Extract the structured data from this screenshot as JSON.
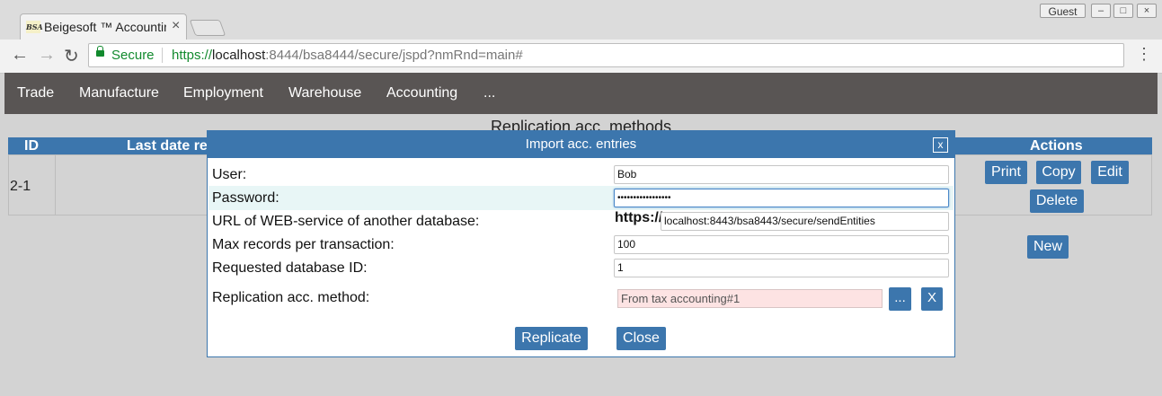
{
  "browser": {
    "tab_title": "Beigesoft ™ Accounting",
    "favicon_text": "BSA",
    "guest_label": "Guest",
    "secure_label": "Secure",
    "url_scheme": "https://",
    "url_host": "localhost",
    "url_path": ":8444/bsa8444/secure/jspd?nmRnd=main#"
  },
  "nav": {
    "items": [
      "Trade",
      "Manufacture",
      "Employment",
      "Warehouse",
      "Accounting",
      "..."
    ]
  },
  "page": {
    "title": "Replication acc. methods",
    "columns": {
      "id": "ID",
      "last_date": "Last date re",
      "actions": "Actions"
    },
    "rows": [
      {
        "id": "2-1"
      }
    ],
    "buttons": {
      "print": "Print",
      "copy": "Copy",
      "edit": "Edit",
      "delete": "Delete",
      "new": "New"
    }
  },
  "modal": {
    "title": "Import acc. entries",
    "close_label": "x",
    "fields": {
      "user_label": "User:",
      "user_value": "Bob",
      "password_label": "Password:",
      "password_value": "•••••••••••••••••",
      "url_label": "URL of WEB-service of another database:",
      "url_prefix": "https://",
      "url_value": "localhost:8443/bsa8443/secure/sendEntities",
      "max_records_label": "Max records per transaction:",
      "max_records_value": "100",
      "db_id_label": "Requested database ID:",
      "db_id_value": "1",
      "method_label": "Replication acc. method:",
      "method_value": "From tax accounting#1",
      "pick_label": "...",
      "clear_label": "X"
    },
    "buttons": {
      "replicate": "Replicate",
      "close": "Close"
    }
  },
  "colors": {
    "accent": "#3c76ad",
    "navbar": "#595554",
    "readonly_bg": "#fde3e3",
    "secure_green": "#128a2e"
  }
}
